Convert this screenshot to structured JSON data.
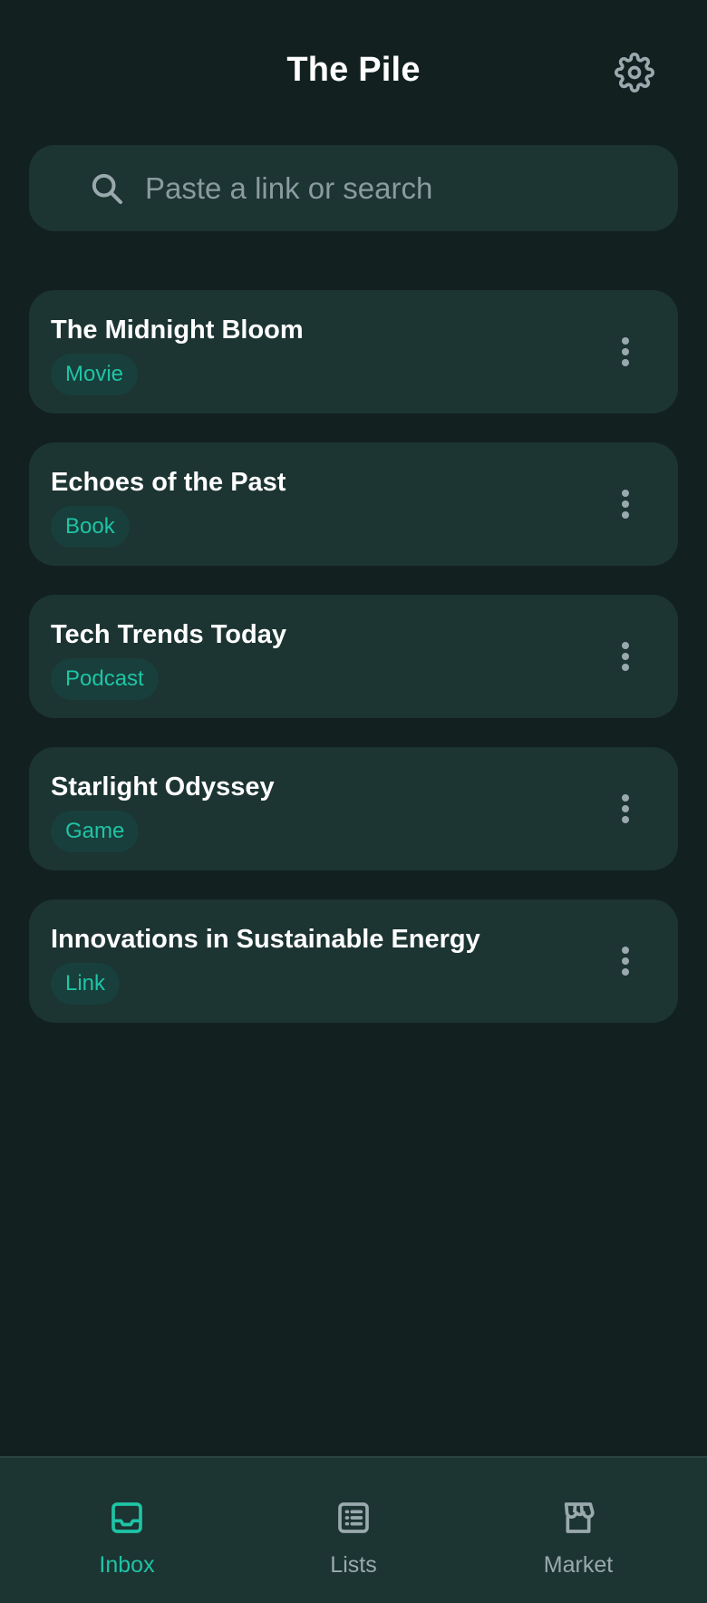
{
  "header": {
    "title": "The Pile",
    "settings_icon": "gear-icon"
  },
  "search": {
    "placeholder": "Paste a link or search",
    "value": "",
    "icon": "search-icon"
  },
  "items": [
    {
      "title": "The Midnight Bloom",
      "tag": "Movie"
    },
    {
      "title": "Echoes of the Past",
      "tag": "Book"
    },
    {
      "title": "Tech Trends Today",
      "tag": "Podcast"
    },
    {
      "title": "Starlight Odyssey",
      "tag": "Game"
    },
    {
      "title": "Innovations in Sustainable Energy",
      "tag": "Link"
    }
  ],
  "nav": {
    "items": [
      {
        "label": "Inbox",
        "icon": "inbox-icon",
        "active": true
      },
      {
        "label": "Lists",
        "icon": "list-icon",
        "active": false
      },
      {
        "label": "Market",
        "icon": "store-icon",
        "active": false
      }
    ]
  },
  "colors": {
    "background": "#122020",
    "card": "#1c3432",
    "accent": "#1ec4a6",
    "tag_background": "#183f3b",
    "muted": "#9aa9ad"
  }
}
